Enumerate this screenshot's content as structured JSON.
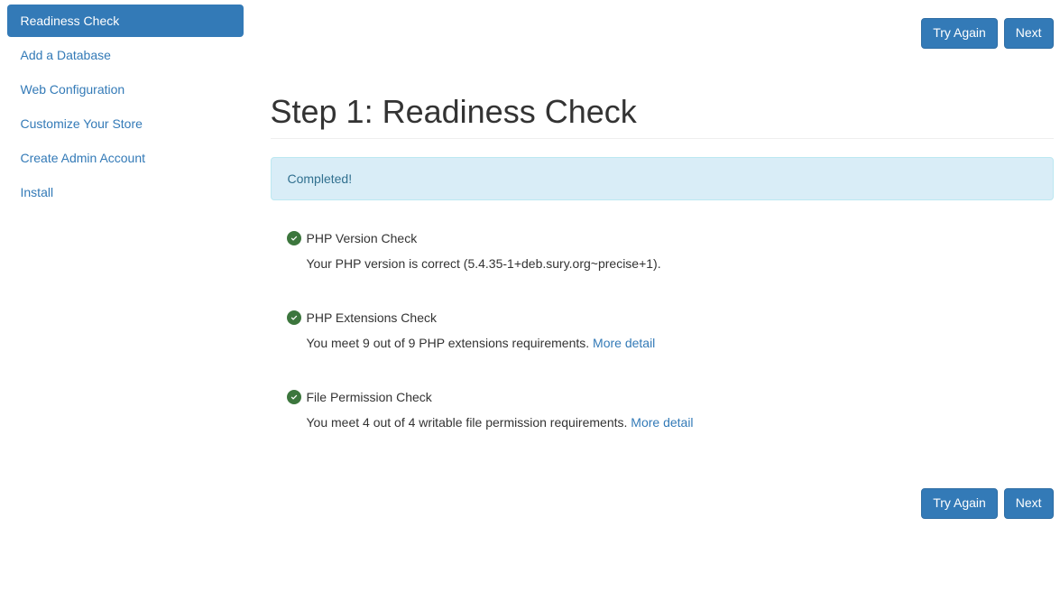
{
  "actions": {
    "try_again": "Try Again",
    "next": "Next"
  },
  "sidebar": {
    "items": [
      {
        "label": "Readiness Check",
        "active": true
      },
      {
        "label": "Add a Database",
        "active": false
      },
      {
        "label": "Web Configuration",
        "active": false
      },
      {
        "label": "Customize Your Store",
        "active": false
      },
      {
        "label": "Create Admin Account",
        "active": false
      },
      {
        "label": "Install",
        "active": false
      }
    ]
  },
  "main": {
    "title": "Step 1: Readiness Check",
    "status_banner": "Completed!",
    "checks": [
      {
        "title": "PHP Version Check",
        "detail": "Your PHP version is correct (5.4.35-1+deb.sury.org~precise+1).",
        "more": null
      },
      {
        "title": "PHP Extensions Check",
        "detail": "You meet 9 out of 9 PHP extensions requirements. ",
        "more": "More detail"
      },
      {
        "title": "File Permission Check",
        "detail": "You meet 4 out of 4 writable file permission requirements. ",
        "more": "More detail"
      }
    ]
  }
}
